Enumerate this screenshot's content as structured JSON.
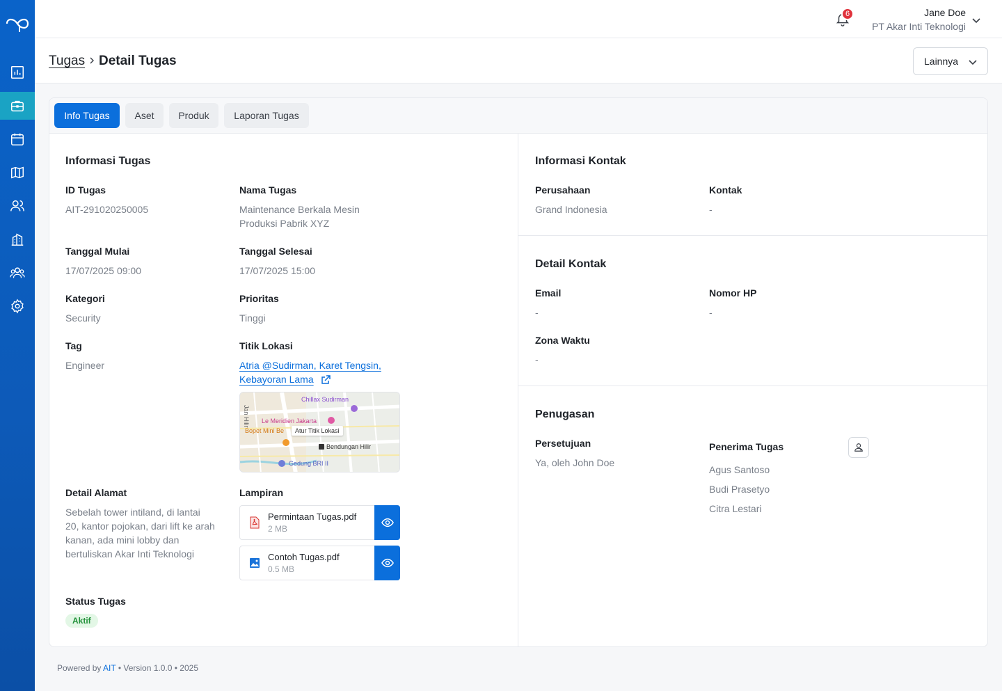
{
  "app": {
    "brand_color": "#0b6fdc"
  },
  "sidebar": {
    "items": [
      {
        "icon": "chart-icon",
        "active": false
      },
      {
        "icon": "briefcase-icon",
        "active": true
      },
      {
        "icon": "calendar-icon",
        "active": false
      },
      {
        "icon": "map-icon",
        "active": false
      },
      {
        "icon": "users-icon",
        "active": false
      },
      {
        "icon": "building-icon",
        "active": false
      },
      {
        "icon": "team-icon",
        "active": false
      },
      {
        "icon": "settings-icon",
        "active": false
      }
    ]
  },
  "header": {
    "notification_count": "6",
    "user_name": "Jane Doe",
    "user_company": "PT Akar Inti Teknologi"
  },
  "breadcrumb": {
    "parent": "Tugas",
    "current": "Detail Tugas"
  },
  "actions": {
    "more_label": "Lainnya"
  },
  "tabs": [
    {
      "label": "Info Tugas",
      "active": true
    },
    {
      "label": "Aset",
      "active": false
    },
    {
      "label": "Produk",
      "active": false
    },
    {
      "label": "Laporan Tugas",
      "active": false
    }
  ],
  "task_info": {
    "title": "Informasi Tugas",
    "id_label": "ID Tugas",
    "id_value": "AIT-291020250005",
    "name_label": "Nama Tugas",
    "name_value_1": "Maintenance Berkala Mesin",
    "name_value_2": "Produksi Pabrik XYZ",
    "start_label": "Tanggal Mulai",
    "start_value": "17/07/2025 09:00",
    "end_label": "Tanggal Selesai",
    "end_value": "17/07/2025 15:00",
    "category_label": "Kategori",
    "category_value": "Security",
    "priority_label": "Prioritas",
    "priority_value": "Tinggi",
    "tag_label": "Tag",
    "tag_value": "Engineer",
    "location_label": "Titik Lokasi",
    "location_value_1": "Atria @Sudirman, Karet Tengsin,",
    "location_value_2": "Kebayoran Lama",
    "address_label": "Detail Alamat",
    "address_lines": [
      "Sebelah tower intiland, di lantai",
      "20, kantor pojokan, dari lift ke arah",
      "kanan, ada mini lobby dan",
      "bertuliskan Akar Inti Teknologi"
    ],
    "attachments_label": "Lampiran",
    "attachments": [
      {
        "name": "Permintaan Tugas.pdf",
        "size": "2 MB",
        "icon": "pdf-file-icon"
      },
      {
        "name": "Contoh Tugas.pdf",
        "size": "0.5 MB",
        "icon": "image-file-icon"
      }
    ],
    "status_label": "Status Tugas",
    "status_value": "Aktif"
  },
  "map": {
    "labels": {
      "chillax": "Chillax Sudirman",
      "meridien": "Le Meridien Jakarta",
      "bopet": "Bopet Mini Be",
      "pin": "Atur Titik Lokasi",
      "bendungan": "Bendungan Hilir",
      "gedung": "Gedung BRI II",
      "road": "Jan Hilir"
    }
  },
  "contact_info": {
    "title": "Informasi Kontak",
    "company_label": "Perusahaan",
    "company_value": "Grand Indonesia",
    "contact_label": "Kontak",
    "contact_value": "-"
  },
  "contact_detail": {
    "title": "Detail Kontak",
    "email_label": "Email",
    "email_value": "-",
    "phone_label": "Nomor HP",
    "phone_value": "-",
    "timezone_label": "Zona Waktu",
    "timezone_value": "-"
  },
  "assignment": {
    "title": "Penugasan",
    "approval_label": "Persetujuan",
    "approval_value": "Ya, oleh John Doe",
    "assignees_label": "Penerima Tugas",
    "assignees": [
      "Agus Santoso",
      "Budi Prasetyo",
      "Citra Lestari"
    ]
  },
  "footer": {
    "powered": "Powered by",
    "brand": "AIT",
    "rest": "• Version 1.0.0 • 2025"
  }
}
